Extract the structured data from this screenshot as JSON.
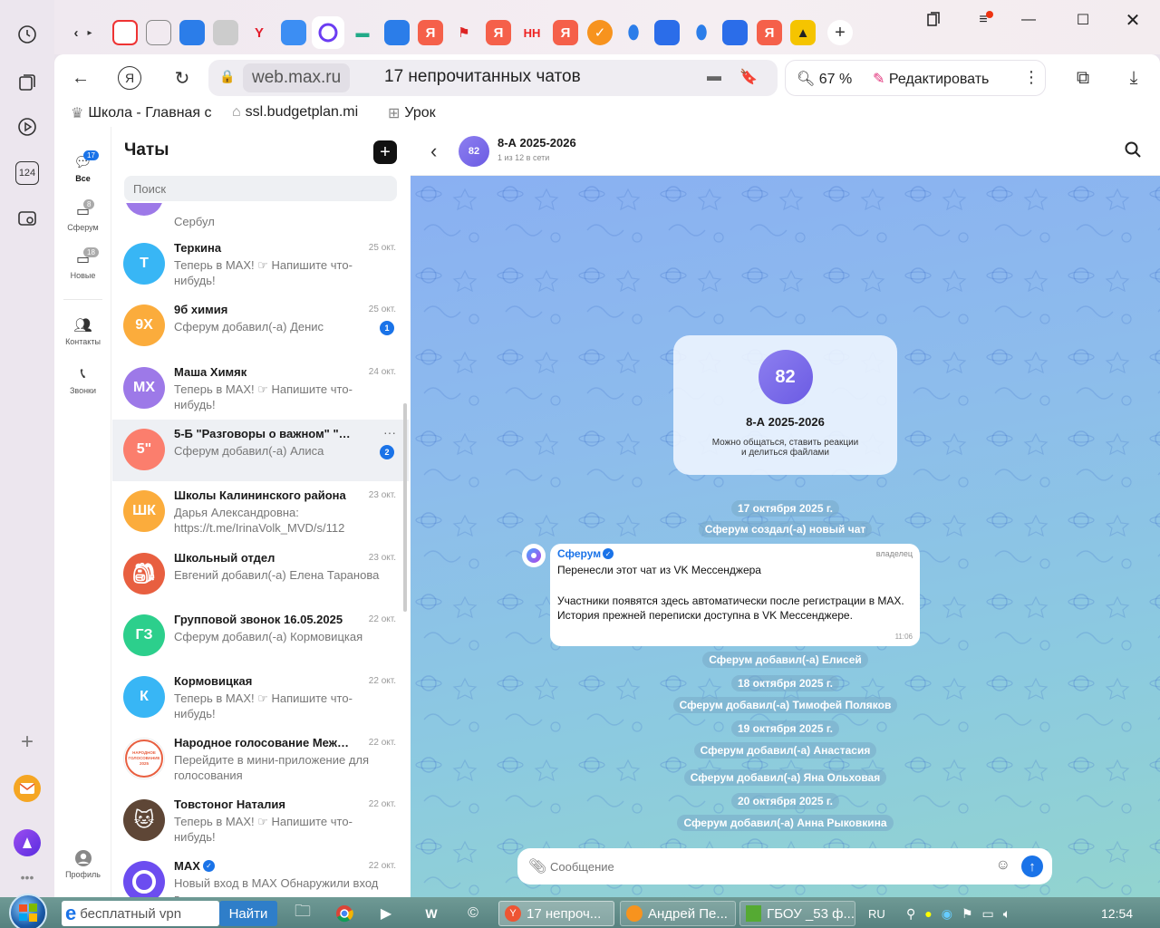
{
  "browser": {
    "url": "web.max.ru",
    "page_title": "17 непрочитанных чатов",
    "zoom": "67 %",
    "edit_label": "Редактировать",
    "tab_glyphs": [
      "Y",
      "Y",
      "Я",
      "НН",
      "Я"
    ],
    "bookmarks": [
      {
        "label": "Школа - Главная с",
        "icon": "gov-emblem-icon"
      },
      {
        "label": "ssl.budgetplan.mi",
        "icon": "bank-icon"
      },
      {
        "label": "Урок",
        "icon": "grid-icon"
      }
    ],
    "rail_badge": "124"
  },
  "nav": {
    "items": [
      {
        "label": "Все",
        "badge": "17"
      },
      {
        "label": "Сферум",
        "badge": "8"
      },
      {
        "label": "Новые",
        "badge": "18"
      },
      {
        "label": "Контакты"
      },
      {
        "label": "Звонки"
      },
      {
        "label": "Профиль"
      }
    ]
  },
  "sidebar": {
    "title": "Чаты",
    "search_placeholder": "Поиск",
    "partial_item": "Сербул",
    "chats": [
      {
        "initials": "Т",
        "name": "Теркина",
        "time": "25 окт.",
        "snippet": "Теперь в MAX! ☞ Напишите что-нибудь!",
        "color": "#38b6f5"
      },
      {
        "initials": "9Х",
        "name": "9б химия",
        "time": "25 окт.",
        "snippet": "Сферум добавил(-а) Денис",
        "unread": "1",
        "color": "#fbac3c"
      },
      {
        "initials": "МХ",
        "name": "Маша Химяк",
        "time": "24 окт.",
        "snippet": "Теперь в MAX! ☞ Напишите что-нибудь!",
        "color": "#9d79e8"
      },
      {
        "initials": "5\"",
        "name": "5-Б \"Разговоры о важном\" \"Пр...",
        "time": "",
        "snippet": "Сферум добавил(-а) Алиса",
        "unread": "2",
        "color": "#fb7e6d",
        "more": "···"
      },
      {
        "initials": "ШК",
        "name": "Школы Калининского района",
        "time": "23 окт.",
        "snippet": "Дарья Александровна: https://t.me/IrinaVolk_MVD/s/112",
        "color": "#fbac3c"
      },
      {
        "initials": "",
        "name": "Школьный отдел",
        "time": "23 окт.",
        "snippet": "Евгений добавил(-а) Елена Таранова",
        "color": "#e85f40"
      },
      {
        "initials": "ГЗ",
        "name": "Групповой звонок 16.05.2025",
        "time": "22 окт.",
        "snippet": "Сферум добавил(-а) Кормовицкая",
        "color": "#2ccf8c"
      },
      {
        "initials": "К",
        "name": "Кормовицкая",
        "time": "22 окт.",
        "snippet": "Теперь в MAX! ☞ Напишите что-нибудь!",
        "color": "#38b6f5"
      },
      {
        "initials": "",
        "name": "Народное голосование Между...",
        "time": "22 окт.",
        "snippet": "Перейдите в мини-приложение для голосования",
        "color": "#ffffff",
        "badge_lines": [
          "НАРОДНОЕ",
          "ГОЛОСОВАНИЕ",
          "2025"
        ]
      },
      {
        "initials": "",
        "name": "Товстоног Наталия",
        "time": "22 окт.",
        "snippet": "Теперь в MAX! ☞ Напишите что-нибудь!",
        "color": "#5e4636"
      },
      {
        "initials": "",
        "name": "MAX",
        "time": "22 окт.",
        "snippet": "Новый вход в MAX Обнаружили вход в",
        "color": "#6c4df0"
      }
    ]
  },
  "chat": {
    "avatar": "82",
    "name": "8-А 2025-2026",
    "status": "1 из 12 в сети",
    "card_title": "8-А 2025-2026",
    "card_desc_1": "Можно общаться, ставить реакции",
    "card_desc_2": "и делиться файлами",
    "system_top": [
      "17 октября 2025 г.",
      "Сферум создал(-а) новый чат"
    ],
    "message": {
      "sender": "Сферум",
      "role": "владелец",
      "line1": "Перенесли этот чат из VK Мессенджера",
      "line2": "Участники появятся здесь автоматически после регистрации в MAX.",
      "line3": "История прежней переписки доступна в VK Мессенджере.",
      "time": "11:06"
    },
    "events": [
      "Сферум добавил(-а) Елисей",
      "18 октября 2025 г.",
      "Сферум добавил(-а) Тимофей Поляков",
      "19 октября 2025 г.",
      "Сферум добавил(-а) Анастасия",
      "Сферум добавил(-а) Яна Ольховая",
      "20 октября 2025 г.",
      "Сферум добавил(-а) Анна Рыковкина"
    ],
    "input_placeholder": "Сообщение"
  },
  "taskbar": {
    "search_text": "бесплатный vpn",
    "search_button": "Найти",
    "windows": [
      "17 непроч...",
      "Андрей Пе...",
      "ГБОУ _53 ф..."
    ],
    "lang": "RU",
    "clock": "12:54"
  }
}
